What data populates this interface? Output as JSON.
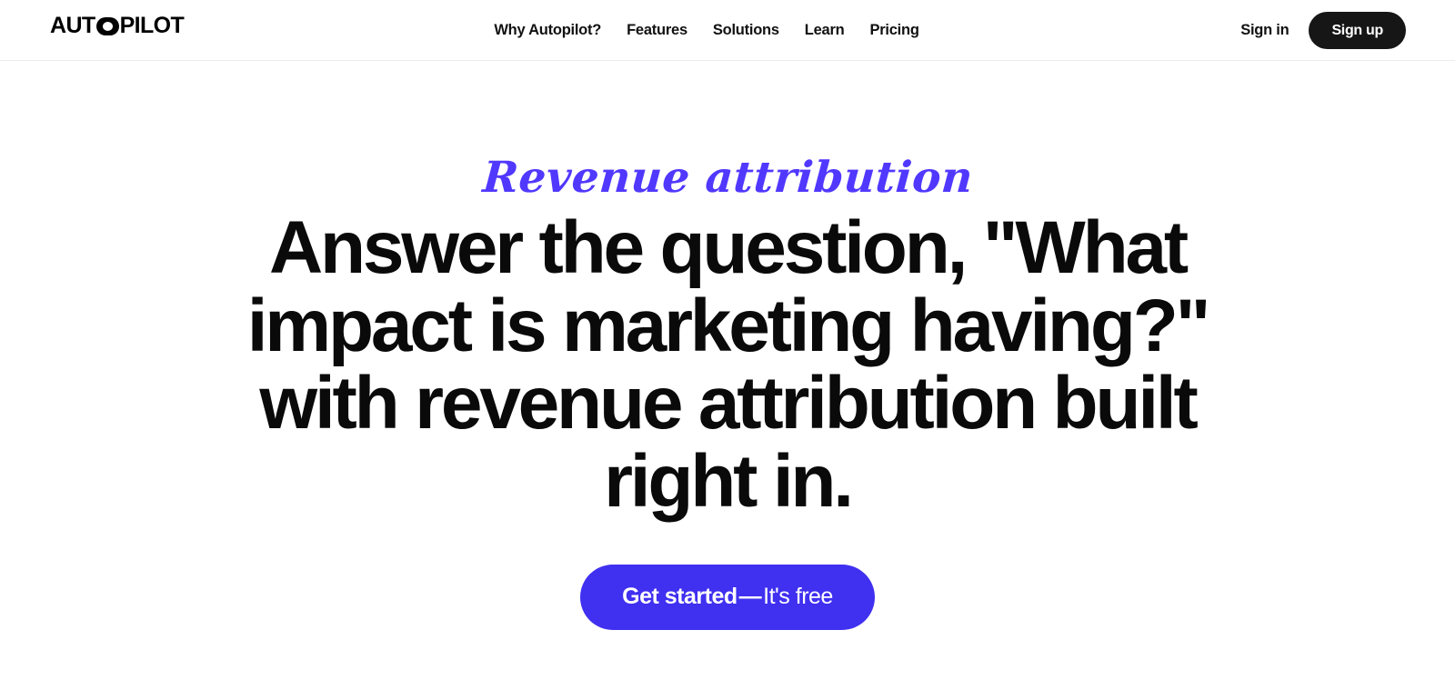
{
  "header": {
    "brand": {
      "name": "AUTOPILOT",
      "part_one": "AUT",
      "part_two": "PILOT",
      "logo_icon": "autopilot-eye-o-icon"
    },
    "nav": [
      {
        "label": "Why Autopilot?",
        "key": "why-autopilot"
      },
      {
        "label": "Features",
        "key": "features"
      },
      {
        "label": "Solutions",
        "key": "solutions"
      },
      {
        "label": "Learn",
        "key": "learn"
      },
      {
        "label": "Pricing",
        "key": "pricing"
      }
    ],
    "actions": {
      "sign_in_label": "Sign in",
      "sign_up_label": "Sign up"
    }
  },
  "hero": {
    "eyebrow": "Revenue attribution",
    "headline_lines": [
      "Answer the question, \"What",
      "impact is marketing having?\"",
      "with revenue attribution built",
      "right in."
    ],
    "cta": {
      "strong_label": "Get started",
      "dash": "—",
      "light_label": "It's free"
    }
  },
  "colors": {
    "brand_purple": "#5138ff",
    "cta_purple": "#4030f0",
    "dark": "#161616",
    "text": "#0a0a0a",
    "background": "#ffffff",
    "header_border": "#ececec"
  }
}
